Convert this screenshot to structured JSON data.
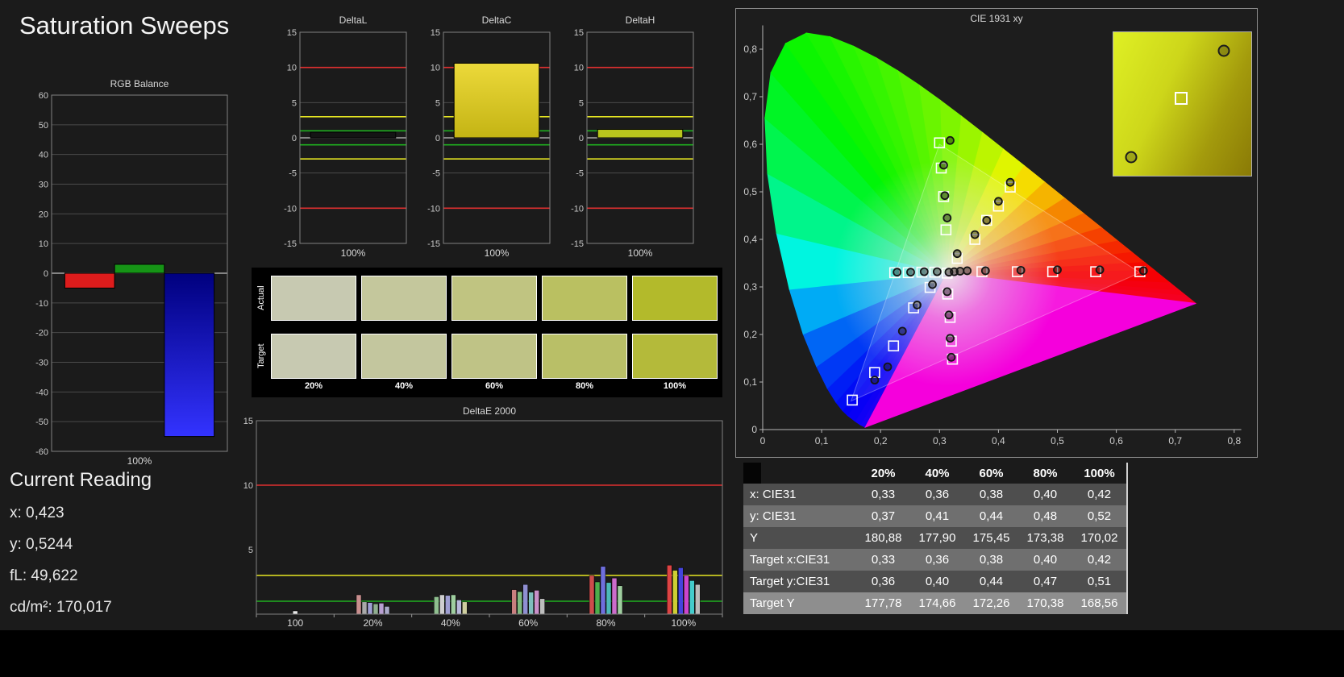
{
  "page": {
    "title": "Saturation Sweeps",
    "background": "#1b1b1b"
  },
  "current_reading": {
    "title": "Current Reading",
    "lines": [
      "x: 0,423",
      "y: 0,5244",
      "fL: 49,622",
      "cd/m²: 170,017"
    ]
  },
  "swatch_panel": {
    "row_labels": [
      "Actual",
      "Target"
    ],
    "col_labels": [
      "20%",
      "40%",
      "60%",
      "80%",
      "100%"
    ],
    "actual_colors": [
      "#c7c9b1",
      "#c4c79c",
      "#c0c481",
      "#bac061",
      "#b3ba2b"
    ],
    "target_colors": [
      "#c7c9b1",
      "#c3c69e",
      "#bfc386",
      "#b9bf67",
      "#b4ba3a"
    ]
  },
  "table": {
    "columns": [
      "20%",
      "40%",
      "60%",
      "80%",
      "100%"
    ],
    "rows": [
      {
        "label": "x: CIE31",
        "values": [
          "0,33",
          "0,36",
          "0,38",
          "0,40",
          "0,42"
        ],
        "shade": "dark"
      },
      {
        "label": "y: CIE31",
        "values": [
          "0,37",
          "0,41",
          "0,44",
          "0,48",
          "0,52"
        ],
        "shade": "medium"
      },
      {
        "label": "Y",
        "values": [
          "180,88",
          "177,90",
          "175,45",
          "173,38",
          "170,02"
        ],
        "shade": "dark"
      },
      {
        "label": "Target x:CIE31",
        "values": [
          "0,33",
          "0,36",
          "0,38",
          "0,40",
          "0,42"
        ],
        "shade": "medium"
      },
      {
        "label": "Target y:CIE31",
        "values": [
          "0,36",
          "0,40",
          "0,44",
          "0,47",
          "0,51"
        ],
        "shade": "dark"
      },
      {
        "label": "Target Y",
        "values": [
          "177,78",
          "174,66",
          "172,26",
          "170,38",
          "168,56"
        ],
        "shade": "light"
      }
    ],
    "shades": {
      "dark": "#4e4e4e",
      "medium": "#6f6f6f",
      "light": "#8e8e8e"
    }
  },
  "chart_data": [
    {
      "id": "rgb_balance",
      "type": "bar",
      "title": "RGB Balance",
      "xlabel": "100%",
      "ylim": [
        -60,
        60
      ],
      "yticks": [
        60,
        50,
        40,
        30,
        20,
        10,
        0,
        -10,
        -20,
        -30,
        -40,
        -50,
        -60
      ],
      "grid_step": 10,
      "bars": [
        {
          "name": "red",
          "value": -5,
          "color": "#dd1c1c"
        },
        {
          "name": "green",
          "value": 3,
          "color": "#169416"
        },
        {
          "name": "blue",
          "value": -55,
          "color": "#1616dd",
          "gradient": [
            "#00007e",
            "#3333ff"
          ]
        }
      ]
    },
    {
      "id": "deltaL",
      "type": "bar",
      "title": "DeltaL",
      "xlabel": "100%",
      "ylim": [
        -15,
        15
      ],
      "yticks": [
        15,
        10,
        5,
        0,
        -5,
        -10,
        -15
      ],
      "grid_step": 5,
      "ref_lines": [
        {
          "value": 10,
          "color": "#e03030"
        },
        {
          "value": -10,
          "color": "#e03030"
        },
        {
          "value": 3,
          "color": "#e6e622"
        },
        {
          "value": -3,
          "color": "#e6e622"
        },
        {
          "value": 1,
          "color": "#1faf1f"
        },
        {
          "value": -1,
          "color": "#1faf1f"
        }
      ],
      "bars": [
        {
          "name": "deltaL-100",
          "value": 0.8,
          "color": "#141414"
        }
      ]
    },
    {
      "id": "deltaC",
      "type": "bar",
      "title": "DeltaC",
      "xlabel": "100%",
      "ylim": [
        -15,
        15
      ],
      "yticks": [
        15,
        10,
        5,
        0,
        -5,
        -10,
        -15
      ],
      "grid_step": 5,
      "ref_lines": [
        {
          "value": 10,
          "color": "#e03030"
        },
        {
          "value": -10,
          "color": "#e03030"
        },
        {
          "value": 3,
          "color": "#e6e622"
        },
        {
          "value": -3,
          "color": "#e6e622"
        },
        {
          "value": 1,
          "color": "#1faf1f"
        },
        {
          "value": -1,
          "color": "#1faf1f"
        }
      ],
      "bars": [
        {
          "name": "deltaC-100",
          "value": 10.6,
          "color": "#d8c51b",
          "gradient": [
            "#ecd93a",
            "#c4b414"
          ]
        }
      ]
    },
    {
      "id": "deltaH",
      "type": "bar",
      "title": "DeltaH",
      "xlabel": "100%",
      "ylim": [
        -15,
        15
      ],
      "yticks": [
        15,
        10,
        5,
        0,
        -5,
        -10,
        -15
      ],
      "grid_step": 5,
      "ref_lines": [
        {
          "value": 10,
          "color": "#e03030"
        },
        {
          "value": -10,
          "color": "#e03030"
        },
        {
          "value": 3,
          "color": "#e6e622"
        },
        {
          "value": -3,
          "color": "#e6e622"
        },
        {
          "value": 1,
          "color": "#1faf1f"
        },
        {
          "value": -1,
          "color": "#1faf1f"
        }
      ],
      "bars": [
        {
          "name": "deltaH-100",
          "value": 1.2,
          "color": "#b9c41d"
        }
      ]
    },
    {
      "id": "deltaE2000",
      "type": "grouped_bar",
      "title": "DeltaE 2000",
      "ylim": [
        0,
        15
      ],
      "yticks": [
        15,
        10,
        5
      ],
      "ref_lines": [
        {
          "value": 10,
          "color": "#e03030"
        },
        {
          "value": 3,
          "color": "#e6e622"
        },
        {
          "value": 1,
          "color": "#1faf1f"
        }
      ],
      "groups": [
        {
          "label": "100",
          "bars": [
            {
              "color": "#e8e8e8",
              "value": 0.25
            }
          ]
        },
        {
          "label": "20%",
          "bars": [
            {
              "color": "#c98f8f",
              "value": 1.5
            },
            {
              "color": "#a9a9a9",
              "value": 0.95
            },
            {
              "color": "#9f9fd2",
              "value": 0.9
            },
            {
              "color": "#8fae8f",
              "value": 0.8
            },
            {
              "color": "#b89fd2",
              "value": 0.85
            },
            {
              "color": "#a9a9c9",
              "value": 0.6
            }
          ]
        },
        {
          "label": "40%",
          "bars": [
            {
              "color": "#8fbe8f",
              "value": 1.35
            },
            {
              "color": "#cfcfcf",
              "value": 1.5
            },
            {
              "color": "#9f9fd2",
              "value": 1.45
            },
            {
              "color": "#9fce9f",
              "value": 1.5
            },
            {
              "color": "#b8b8da",
              "value": 1.1
            },
            {
              "color": "#cfcf9f",
              "value": 0.95
            }
          ]
        },
        {
          "label": "60%",
          "bars": [
            {
              "color": "#c97f7f",
              "value": 1.9
            },
            {
              "color": "#7fb97f",
              "value": 1.75
            },
            {
              "color": "#8f8fd2",
              "value": 2.3
            },
            {
              "color": "#7fbebe",
              "value": 1.7
            },
            {
              "color": "#c98fc9",
              "value": 1.85
            },
            {
              "color": "#bdbdbd",
              "value": 1.2
            }
          ]
        },
        {
          "label": "80%",
          "bars": [
            {
              "color": "#cc4c4c",
              "value": 3.0
            },
            {
              "color": "#4cae4c",
              "value": 2.5
            },
            {
              "color": "#6f6fdd",
              "value": 3.7
            },
            {
              "color": "#4cb8b8",
              "value": 2.45
            },
            {
              "color": "#cc6ccc",
              "value": 2.8
            },
            {
              "color": "#9fce9f",
              "value": 2.2
            }
          ]
        },
        {
          "label": "100%",
          "bars": [
            {
              "color": "#dd4444",
              "value": 3.8
            },
            {
              "color": "#cece33",
              "value": 3.4
            },
            {
              "color": "#4444dd",
              "value": 3.6
            },
            {
              "color": "#cc44cc",
              "value": 3.0
            },
            {
              "color": "#44cccc",
              "value": 2.6
            },
            {
              "color": "#bbbbbb",
              "value": 2.3
            }
          ]
        }
      ]
    },
    {
      "id": "cie",
      "type": "scatter",
      "title": "CIE 1931 xy",
      "xlim": [
        0,
        0.85
      ],
      "ylim": [
        0,
        0.85
      ],
      "xticks": [
        {
          "v": 0,
          "label": "0"
        },
        {
          "v": 0.1,
          "label": "0,1"
        },
        {
          "v": 0.2,
          "label": "0,2"
        },
        {
          "v": 0.3,
          "label": "0,3"
        },
        {
          "v": 0.4,
          "label": "0,4"
        },
        {
          "v": 0.5,
          "label": "0,5"
        },
        {
          "v": 0.6,
          "label": "0,6"
        },
        {
          "v": 0.7,
          "label": "0,7"
        },
        {
          "v": 0.8,
          "label": "0,8"
        }
      ],
      "yticks": [
        {
          "v": 0,
          "label": "0"
        },
        {
          "v": 0.1,
          "label": "0,1"
        },
        {
          "v": 0.2,
          "label": "0,2"
        },
        {
          "v": 0.3,
          "label": "0,3"
        },
        {
          "v": 0.4,
          "label": "0,4"
        },
        {
          "v": 0.5,
          "label": "0,5"
        },
        {
          "v": 0.6,
          "label": "0,6"
        },
        {
          "v": 0.7,
          "label": "0,7"
        },
        {
          "v": 0.8,
          "label": "0,8"
        }
      ],
      "white_point": [
        0.3127,
        0.329
      ],
      "gamut_triangle": [
        [
          0.64,
          0.33
        ],
        [
          0.3,
          0.6
        ],
        [
          0.15,
          0.06
        ]
      ],
      "locus": [
        [
          0.1741,
          0.005
        ],
        [
          0.1658,
          0.0099
        ],
        [
          0.1566,
          0.0177
        ],
        [
          0.144,
          0.0297
        ],
        [
          0.1355,
          0.0399
        ],
        [
          0.1241,
          0.0578
        ],
        [
          0.1096,
          0.0868
        ],
        [
          0.0913,
          0.1327
        ],
        [
          0.0687,
          0.2007
        ],
        [
          0.0454,
          0.295
        ],
        [
          0.0235,
          0.4127
        ],
        [
          0.0082,
          0.5384
        ],
        [
          0.0039,
          0.6548
        ],
        [
          0.0139,
          0.7502
        ],
        [
          0.0389,
          0.812
        ],
        [
          0.0743,
          0.8338
        ],
        [
          0.1142,
          0.8262
        ],
        [
          0.1547,
          0.8059
        ],
        [
          0.1929,
          0.7816
        ],
        [
          0.2296,
          0.7543
        ],
        [
          0.2658,
          0.7243
        ],
        [
          0.3016,
          0.6923
        ],
        [
          0.3373,
          0.6589
        ],
        [
          0.3731,
          0.6245
        ],
        [
          0.4087,
          0.5896
        ],
        [
          0.4441,
          0.5547
        ],
        [
          0.4788,
          0.5202
        ],
        [
          0.5125,
          0.4866
        ],
        [
          0.5448,
          0.4544
        ],
        [
          0.5752,
          0.4242
        ],
        [
          0.6029,
          0.3965
        ],
        [
          0.627,
          0.3725
        ],
        [
          0.6482,
          0.3514
        ],
        [
          0.6658,
          0.334
        ],
        [
          0.6915,
          0.3083
        ],
        [
          0.7079,
          0.292
        ],
        [
          0.719,
          0.2809
        ],
        [
          0.7347,
          0.2653
        ]
      ],
      "targets": [
        [
          0.313,
          0.329
        ],
        [
          0.372,
          0.332
        ],
        [
          0.432,
          0.332
        ],
        [
          0.492,
          0.332
        ],
        [
          0.565,
          0.332
        ],
        [
          0.64,
          0.332
        ],
        [
          0.292,
          0.331
        ],
        [
          0.27,
          0.331
        ],
        [
          0.247,
          0.33
        ],
        [
          0.224,
          0.33
        ],
        [
          0.311,
          0.42
        ],
        [
          0.307,
          0.49
        ],
        [
          0.303,
          0.55
        ],
        [
          0.3,
          0.603
        ],
        [
          0.284,
          0.299
        ],
        [
          0.256,
          0.256
        ],
        [
          0.222,
          0.176
        ],
        [
          0.19,
          0.12
        ],
        [
          0.152,
          0.062
        ],
        [
          0.33,
          0.36
        ],
        [
          0.36,
          0.4
        ],
        [
          0.38,
          0.44
        ],
        [
          0.4,
          0.47
        ],
        [
          0.42,
          0.51
        ],
        [
          0.314,
          0.285
        ],
        [
          0.318,
          0.236
        ],
        [
          0.32,
          0.186
        ],
        [
          0.322,
          0.148
        ]
      ],
      "measured": [
        [
          0.316,
          0.331
        ],
        [
          0.325,
          0.332
        ],
        [
          0.335,
          0.333
        ],
        [
          0.347,
          0.334
        ],
        [
          0.378,
          0.334
        ],
        [
          0.438,
          0.335
        ],
        [
          0.5,
          0.336
        ],
        [
          0.572,
          0.336
        ],
        [
          0.646,
          0.334
        ],
        [
          0.296,
          0.332
        ],
        [
          0.274,
          0.332
        ],
        [
          0.251,
          0.331
        ],
        [
          0.228,
          0.331
        ],
        [
          0.313,
          0.445
        ],
        [
          0.309,
          0.492
        ],
        [
          0.307,
          0.556
        ],
        [
          0.318,
          0.608
        ],
        [
          0.288,
          0.305
        ],
        [
          0.262,
          0.262
        ],
        [
          0.237,
          0.207
        ],
        [
          0.212,
          0.132
        ],
        [
          0.19,
          0.104
        ],
        [
          0.33,
          0.37
        ],
        [
          0.36,
          0.41
        ],
        [
          0.38,
          0.44
        ],
        [
          0.4,
          0.48
        ],
        [
          0.42,
          0.52
        ],
        [
          0.313,
          0.29
        ],
        [
          0.316,
          0.241
        ],
        [
          0.318,
          0.192
        ],
        [
          0.32,
          0.152
        ]
      ],
      "inset": {
        "squares": [
          [
            0.49,
            0.46
          ]
        ],
        "circles": [
          [
            0.8,
            0.13
          ],
          [
            0.13,
            0.87
          ]
        ]
      }
    }
  ]
}
